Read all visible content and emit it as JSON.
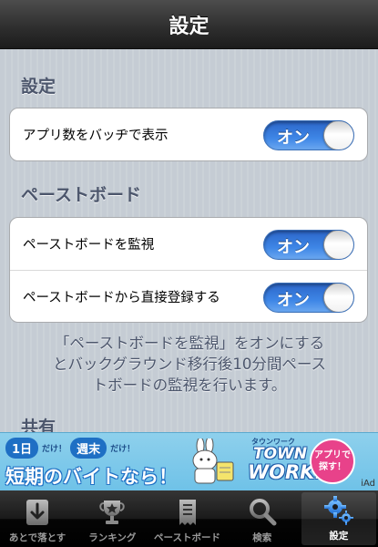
{
  "navbar": {
    "title": "設定"
  },
  "sections": [
    {
      "header": "設定",
      "rows": [
        {
          "label": "アプリ数をバッヂで表示",
          "switch": "オン"
        }
      ]
    },
    {
      "header": "ペーストボード",
      "rows": [
        {
          "label": "ペーストボードを監視",
          "switch": "オン"
        },
        {
          "label": "ペーストボードから直接登録する",
          "switch": "オン"
        }
      ],
      "footer_lines": [
        "「ペーストボードを監視」をオンにする",
        "とバックグラウンド移行後10分間ペース",
        "トボードの監視を行います。"
      ]
    },
    {
      "header": "共有"
    }
  ],
  "ad": {
    "pill1": "1日",
    "small1": "だけ！",
    "pill2": "週末",
    "small2": "だけ！",
    "headline": "短期のバイトなら！",
    "brand_small": "タウンワーク",
    "brand_line1": "TOWN",
    "brand_line2": "WORK.",
    "cta_line1": "アプリで",
    "cta_line2": "探す！",
    "iad": "iAd"
  },
  "tabs": [
    {
      "label": "あとで落とす",
      "icon": "download-tray-icon",
      "selected": false
    },
    {
      "label": "ランキング",
      "icon": "trophy-icon",
      "selected": false
    },
    {
      "label": "ペーストボード",
      "icon": "receipt-icon",
      "selected": false
    },
    {
      "label": "検索",
      "icon": "search-icon",
      "selected": false
    },
    {
      "label": "設定",
      "icon": "gear-icon",
      "selected": true
    }
  ],
  "colors": {
    "switch_on": "#3e86e6",
    "section_text": "#4c566c",
    "navbar": "#2f2f2f",
    "ad_background": "#8ed0ec"
  }
}
